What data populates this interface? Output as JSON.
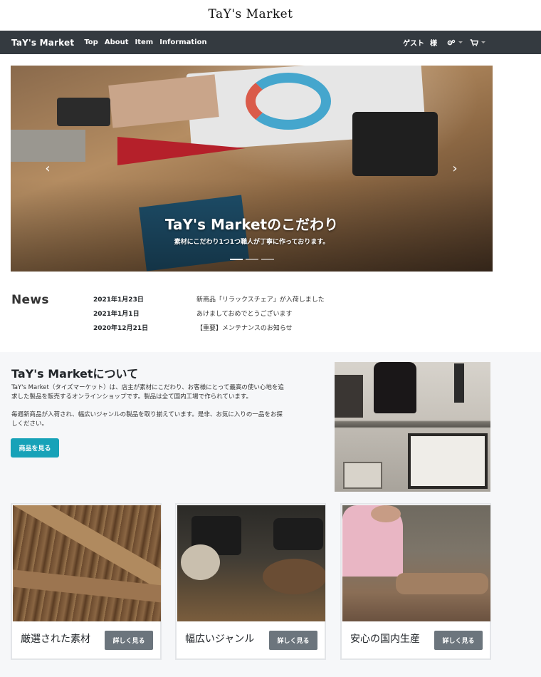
{
  "site_title": "TaY's Market",
  "navbar": {
    "brand": "TaY's Market",
    "links": [
      "Top",
      "About",
      "Item",
      "Information"
    ],
    "guest": "ゲスト",
    "sama": "様"
  },
  "carousel": {
    "title": "TaY's Marketのこだわり",
    "text": "素材にこだわり1つ1つ職人が丁寧に作っております。",
    "prev": "‹",
    "next": "›"
  },
  "news": {
    "heading": "News",
    "items": [
      {
        "date": "2021年1月23日",
        "text": "新商品「リラックスチェア」が入荷しました"
      },
      {
        "date": "2021年1月1日",
        "text": "あけましておめでとうございます"
      },
      {
        "date": "2020年12月21日",
        "text": "【重要】メンテナンスのお知らせ"
      }
    ]
  },
  "about": {
    "title": "TaY's Marketについて",
    "p1_line1": "TaY's Market（タイズマーケット）は、店主が素材にこだわり、お客様にとって最高の使い心地を追",
    "p1_line2": "求した製品を販売するオンラインショップです。製品は全て国内工場で作られています。",
    "p2_line1": "毎週新商品が入荷され、幅広いジャンルの製品を取り揃えています。是非、お気に入りの一品をお探",
    "p2_line2": "しください。",
    "button": "商品を見る"
  },
  "cards": [
    {
      "label": "厳選された素材",
      "button": "詳しく見る"
    },
    {
      "label": "幅広いジャンル",
      "button": "詳しく見る"
    },
    {
      "label": "安心の国内生産",
      "button": "詳しく見る"
    }
  ],
  "colors": {
    "navbar": "#343a40",
    "primary_button": "#17a2b8",
    "secondary_button": "#6c757d",
    "about_bg": "#f6f7f9"
  },
  "icons": [
    "gears-icon",
    "cart-icon",
    "chevron-left-icon",
    "chevron-right-icon"
  ]
}
